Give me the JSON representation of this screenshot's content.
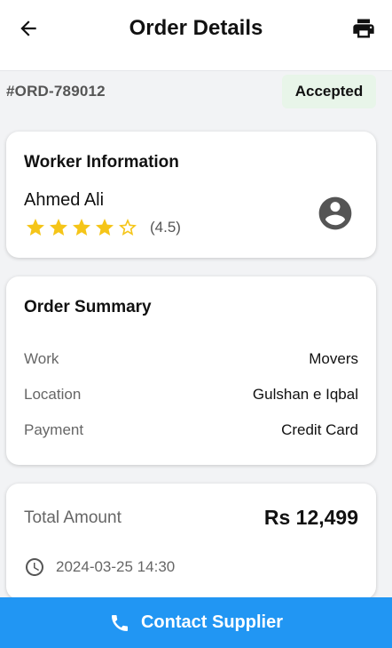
{
  "header": {
    "title": "Order Details",
    "back_icon": "arrow-left-icon",
    "print_icon": "printer-icon"
  },
  "order": {
    "id": "#ORD-789012",
    "status": "Accepted",
    "status_color": "#e8f5e9"
  },
  "worker": {
    "section_title": "Worker Information",
    "name": "Ahmed Ali",
    "rating_value": 4.5,
    "rating_text": "(4.5)",
    "stars_filled": 4,
    "stars_total": 5,
    "star_color": "#f5c518",
    "avatar_icon": "account-circle-icon"
  },
  "summary": {
    "section_title": "Order Summary",
    "rows": [
      {
        "label": "Work",
        "value": "Movers"
      },
      {
        "label": "Location",
        "value": "Gulshan e Iqbal"
      },
      {
        "label": "Payment",
        "value": "Credit Card"
      }
    ]
  },
  "amount": {
    "label": "Total Amount",
    "value": "Rs 12,499",
    "datetime": "2024-03-25 14:30",
    "clock_icon": "clock-icon"
  },
  "contact": {
    "label": "Contact Supplier",
    "icon": "phone-icon",
    "color": "#2196f3"
  }
}
